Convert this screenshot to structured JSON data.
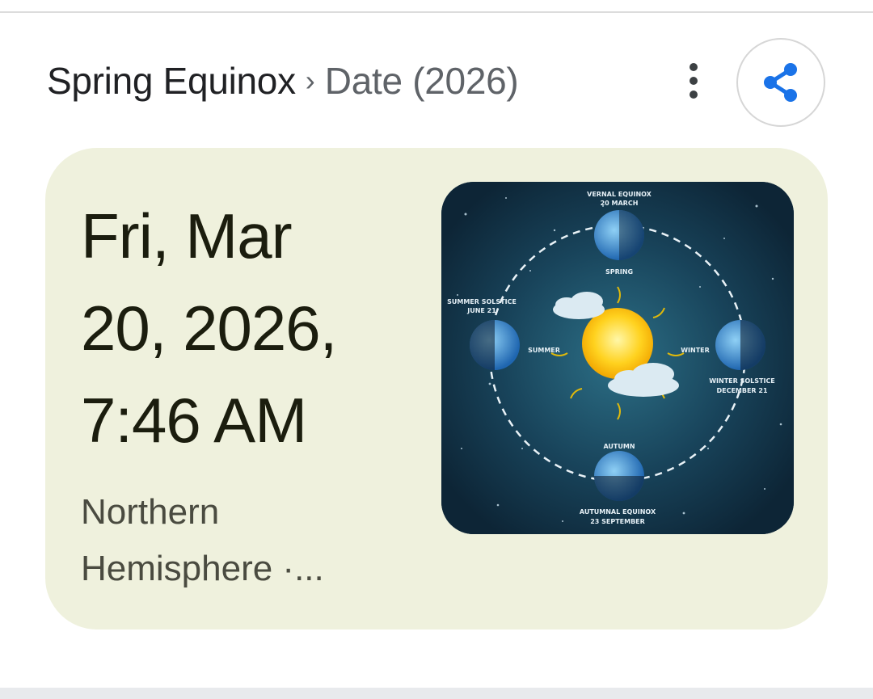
{
  "header": {
    "breadcrumb_primary": "Spring Equinox",
    "breadcrumb_separator": "›",
    "breadcrumb_secondary": "Date (2026)",
    "menu_icon": "more-vert-icon",
    "share_icon": "share-icon",
    "accent_color": "#1a73e8"
  },
  "card": {
    "date_line1": "Fri, Mar",
    "date_line2": "20, 2026,",
    "date_line3": "7:46 AM",
    "region_line1": "Northern",
    "region_line2": "Hemisphere ·...",
    "background_color": "#eff1dd"
  },
  "image": {
    "labels": {
      "vernal": "VERNAL EQUINOX",
      "vernal_date": "20 MARCH",
      "spring": "SPRING",
      "summer_solstice": "SUMMER SOLSTICE",
      "summer_date": "JUNE 21",
      "summer": "SUMMER",
      "winter": "WINTER",
      "winter_solstice": "WINTER SOLSTICE",
      "winter_date": "DECEMBER 21",
      "autumn": "AUTUMN",
      "autumnal": "AUTUMNAL EQUINOX",
      "autumnal_date": "23 SEPTEMBER"
    }
  }
}
